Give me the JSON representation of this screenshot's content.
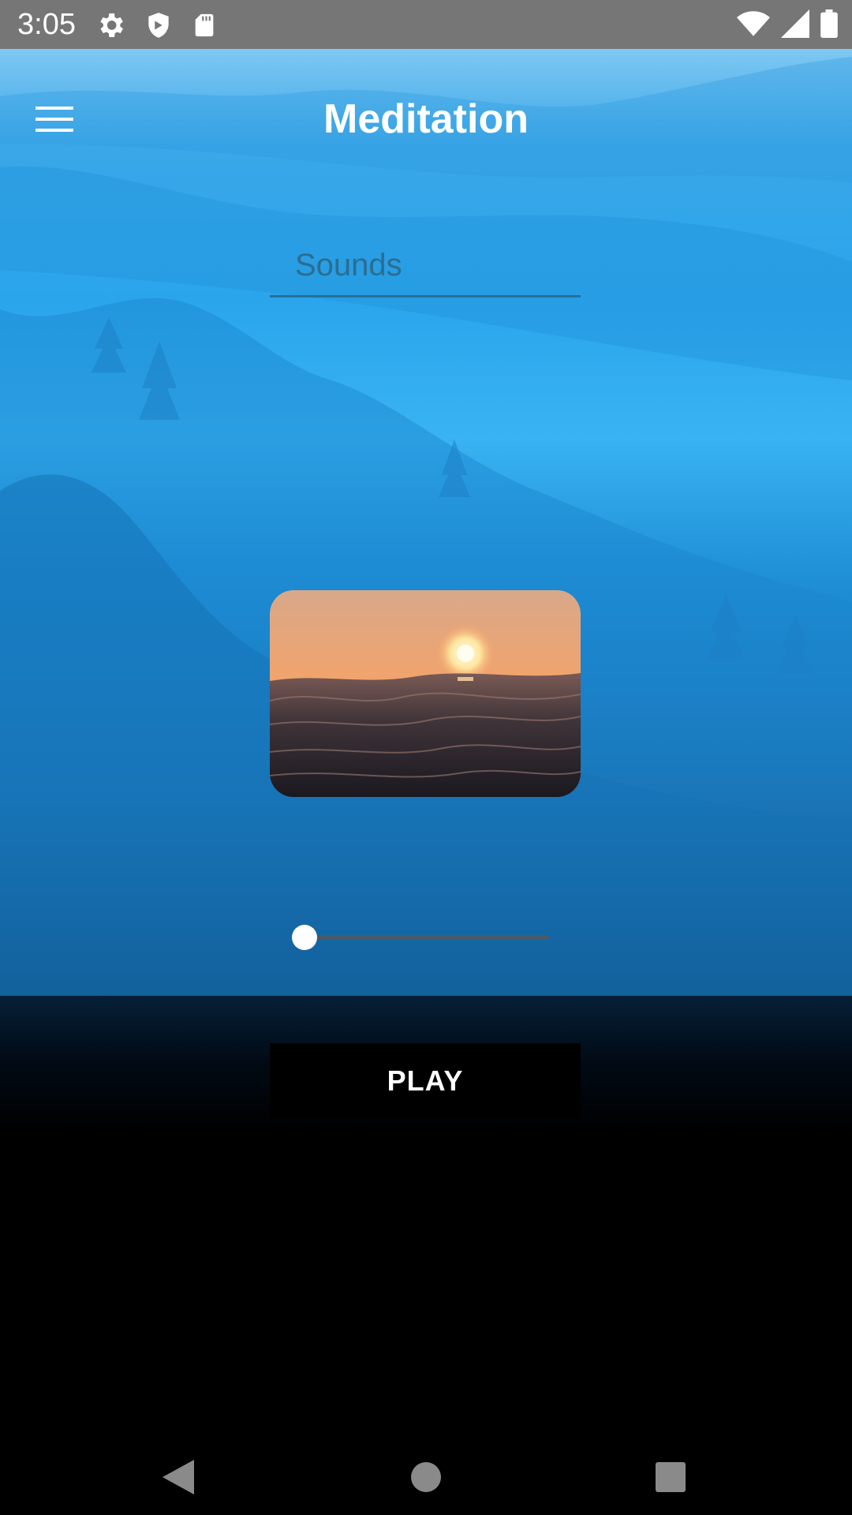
{
  "status_bar": {
    "time": "3:05",
    "left_icons": [
      "settings-icon",
      "shield-icon",
      "sd-card-icon"
    ],
    "right_icons": [
      "wifi-icon",
      "signal-icon",
      "battery-icon"
    ]
  },
  "app_bar": {
    "title": "Meditation",
    "menu_icon": "menu-icon"
  },
  "sound_selector": {
    "value": "Sounds"
  },
  "artwork": {
    "subject": "sunset-over-ocean-waves"
  },
  "seek_slider": {
    "progress": 0.0
  },
  "controls": {
    "play_label": "PLAY"
  },
  "nav_bar": {
    "items": [
      "back-icon",
      "home-icon",
      "recents-icon"
    ]
  },
  "colors": {
    "status_bar": "#767676",
    "sky_top": "#7fc8f2",
    "sky_mid": "#2aa5ec",
    "background_bottom": "#000000",
    "sounds_text": "#2c6d91"
  }
}
